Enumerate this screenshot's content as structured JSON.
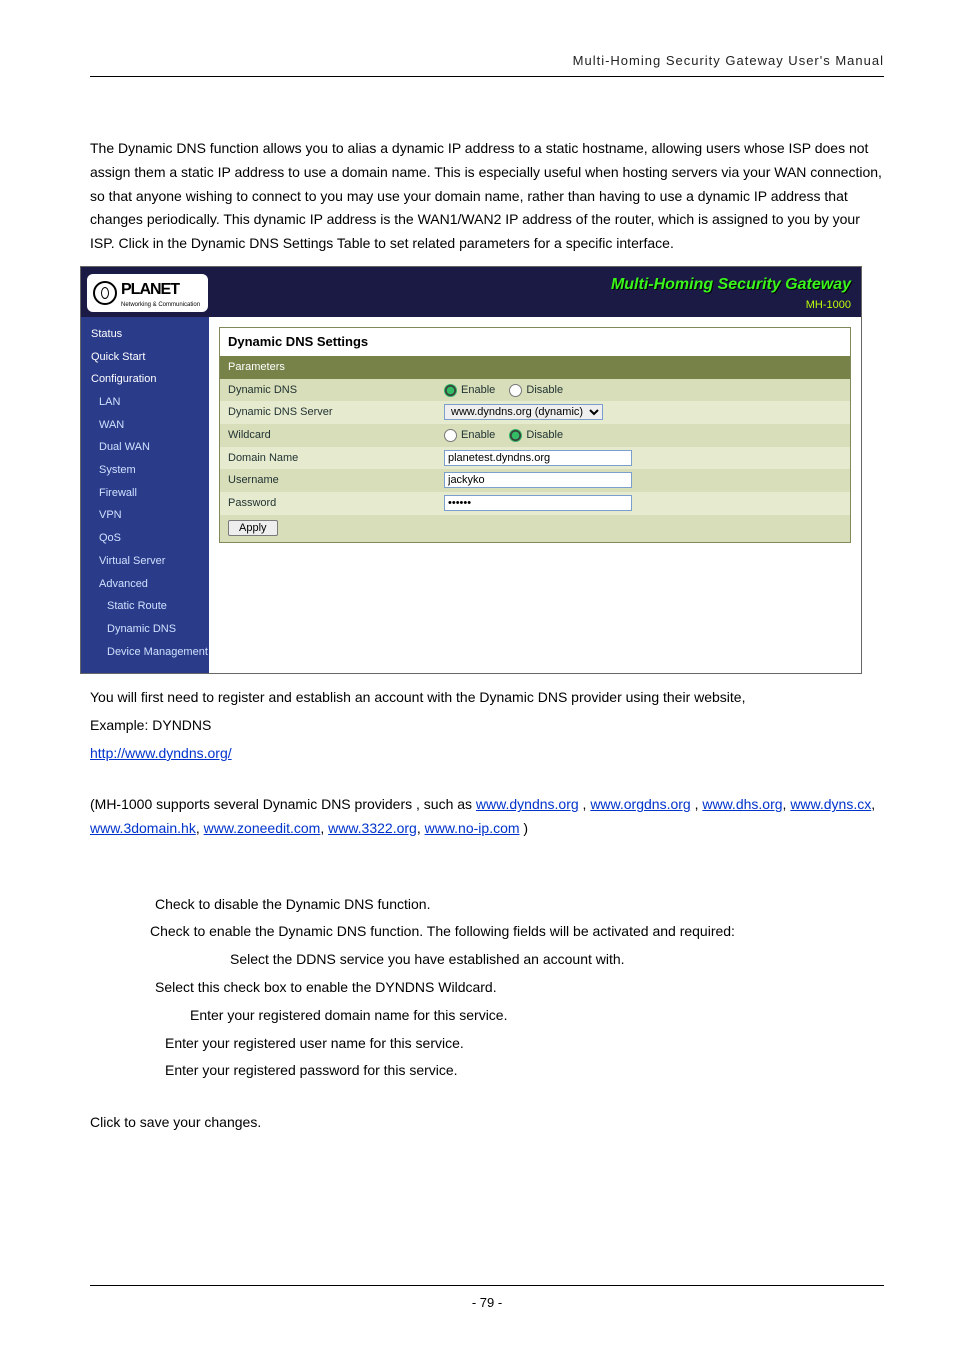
{
  "header": {
    "right": "Multi-Homing  Security  Gateway  User's  Manual"
  },
  "intro": {
    "p1": "The Dynamic DNS function allows you to alias a dynamic IP address to a static hostname, allowing users whose ISP does not assign them a static IP address to use a domain name. This is especially useful when hosting servers via your WAN connection, so that anyone wishing to connect to you may use your domain name, rather than having to use a dynamic IP address that changes periodically. This dynamic IP address is the WAN1/WAN2 IP address of the router, which is assigned to you by your ISP. Click",
    "p1b": " in the Dynamic DNS Settings Table to set related parameters for a specific interface."
  },
  "screenshot": {
    "brand": "PLANET",
    "brand_sub": "Networking & Communication",
    "title": "Multi-Homing Security Gateway",
    "model": "MH-1000",
    "sidebar": {
      "status": "Status",
      "quick": "Quick Start",
      "config": "Configuration",
      "lan": "LAN",
      "wan": "WAN",
      "dual": "Dual WAN",
      "system": "System",
      "firewall": "Firewall",
      "vpn": "VPN",
      "qos": "QoS",
      "virtual": "Virtual Server",
      "advanced": "Advanced",
      "static": "Static Route",
      "ddns": "Dynamic DNS",
      "dev": "Device Management"
    },
    "box_title": "Dynamic DNS Settings",
    "box_sub": "Parameters",
    "rows": {
      "r1": "Dynamic DNS",
      "r1_enable": "Enable",
      "r1_disable": "Disable",
      "r2": "Dynamic DNS Server",
      "r2_val": "www.dyndns.org (dynamic)",
      "r3": "Wildcard",
      "r3_enable": "Enable",
      "r3_disable": "Disable",
      "r4": "Domain Name",
      "r4_val": "planetest.dyndns.org",
      "r5": "Username",
      "r5_val": "jackyko",
      "r6": "Password",
      "r6_val": "••••••"
    },
    "apply": "Apply"
  },
  "after": {
    "l1": "You will first need to register and establish an account with the Dynamic DNS provider using their website,",
    "l2": "Example:    DYNDNS",
    "link1": "http://www.dyndns.org/",
    "mh1a": "(MH-1000 supports several Dynamic DNS providers , such as ",
    "mh_links": {
      "a1": "www.dyndns.org",
      "a2": "www.orgdns.org",
      "a3": "www.dhs.org",
      "a4": "www.dyns.cx",
      "a5": "www.3domain.hk",
      "a6": "www.zoneedit.com",
      "a7": "www.3322.org",
      "a8": "www.no-ip.com"
    },
    "mh1b": " )"
  },
  "bullets": {
    "b1": " Check to disable the Dynamic DNS function.",
    "b2": " Check to enable the Dynamic DNS function. The following fields will be activated and required:",
    "b3": " Select the DDNS service you have established an account with.",
    "b4": " Select this check box to enable the DYNDNS Wildcard.",
    "b5": " Enter your registered domain name for this service.",
    "b6": " Enter your registered user name for this service.",
    "b7": " Enter your registered password for this service."
  },
  "closing": {
    "pre": "Click",
    "post": " to save your changes."
  },
  "footer": {
    "page": "- 79 -"
  }
}
